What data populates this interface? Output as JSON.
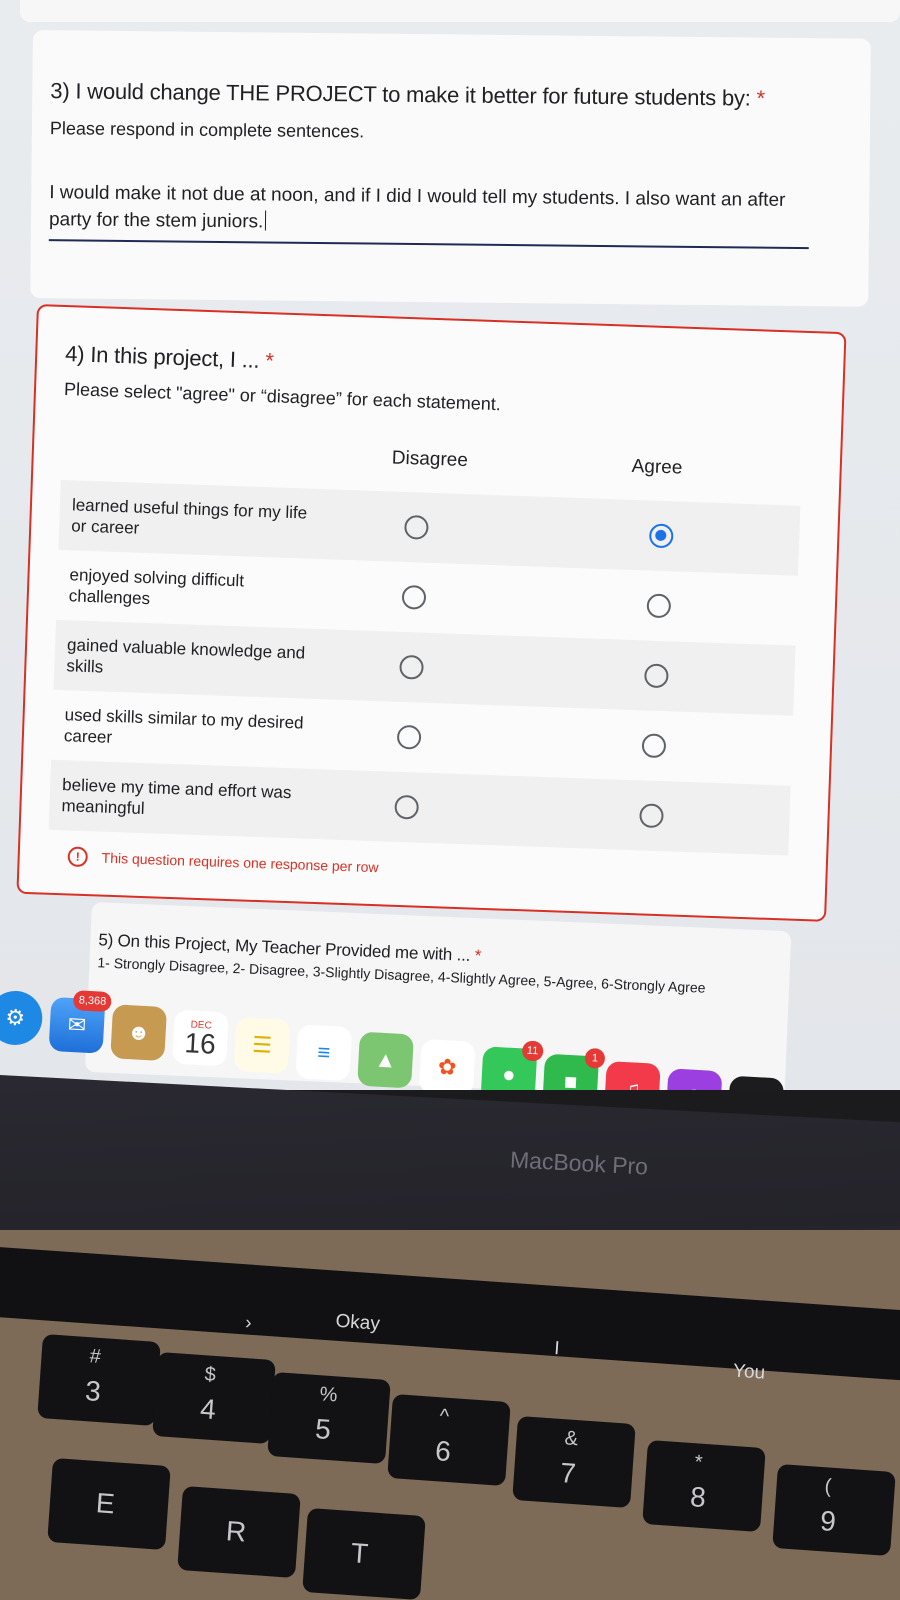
{
  "q3": {
    "title": "3) I would change THE PROJECT to make it better for future students by:",
    "required_mark": "*",
    "subtitle": "Please respond in complete sentences.",
    "answer": "I would make it not due at noon, and if I did I would tell my students. I also want an after party for the stem juniors."
  },
  "q4": {
    "title": "4) In this project, I ...",
    "required_mark": "*",
    "subtitle": "Please select \"agree\" or “disagree”  for each statement.",
    "columns": [
      "Disagree",
      "Agree"
    ],
    "rows": [
      {
        "label": "learned useful things for my life or career",
        "selected": "Agree"
      },
      {
        "label": "enjoyed solving difficult challenges",
        "selected": ""
      },
      {
        "label": "gained valuable knowledge and skills",
        "selected": ""
      },
      {
        "label": "used skills similar to my desired career",
        "selected": ""
      },
      {
        "label": "believe my time and effort was meaningful",
        "selected": ""
      }
    ],
    "error": "This question requires one response per row",
    "error_icon": "!"
  },
  "q5": {
    "title": "5) On this Project, My Teacher Provided me with ...",
    "required_mark": "*",
    "subtitle": "1- Strongly Disagree, 2- Disagree, 3-Slightly Disagree, 4-Slightly Agree, 5-Agree, 6-Strongly Agree"
  },
  "dock": {
    "mail_badge": "8,368",
    "calendar_month": "DEC",
    "calendar_day": "16",
    "messages_badge": "11",
    "facetime_badge": "1",
    "tv_label": "tv"
  },
  "laptop": {
    "brand": "MacBook Pro"
  },
  "touchbar": {
    "suggestions": [
      "Okay",
      "I",
      "You"
    ]
  },
  "keys": [
    {
      "top": "#",
      "bottom": "3"
    },
    {
      "top": "$",
      "bottom": "4"
    },
    {
      "top": "%",
      "bottom": "5"
    },
    {
      "top": "^",
      "bottom": "6"
    },
    {
      "top": "&",
      "bottom": "7"
    },
    {
      "top": "*",
      "bottom": "8"
    },
    {
      "top": "(",
      "bottom": "9"
    }
  ],
  "letter_keys": [
    "E",
    "R",
    "T"
  ],
  "colors": {
    "required": "#d93025",
    "radio_selected": "#1a73e8",
    "error": "#d93025"
  }
}
